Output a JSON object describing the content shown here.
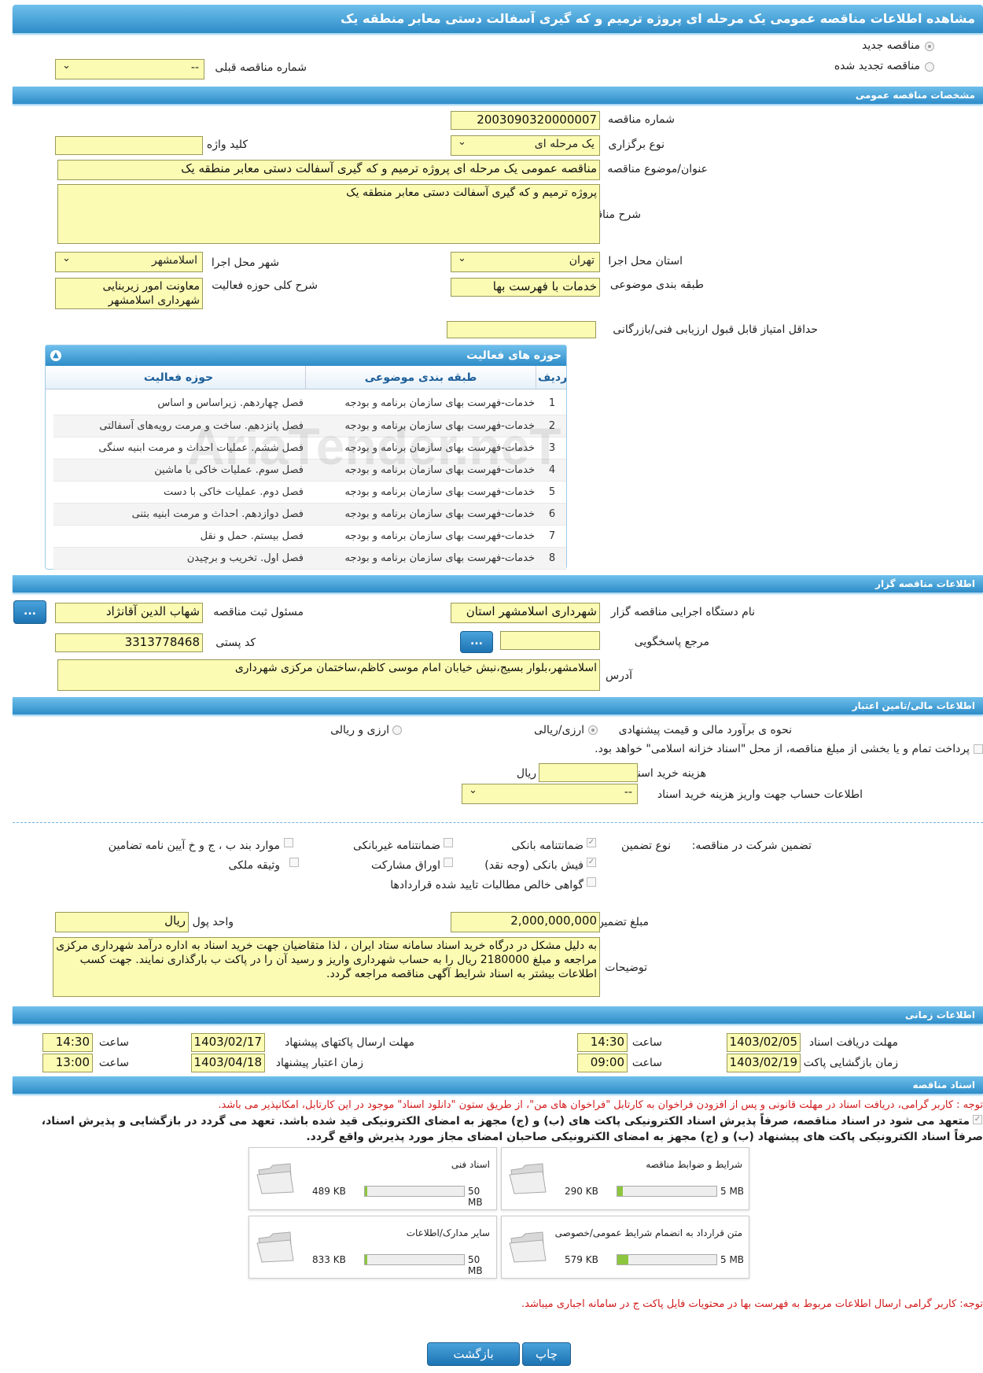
{
  "header": {
    "title": "مشاهده اطلاعات مناقصه عمومی یک مرحله ای پروژه ترمیم و که گیری آسفالت دستی معابر منطقه یک"
  },
  "top": {
    "new_tender": "مناقصه جدید",
    "renewed_tender": "مناقصه تجدید شده",
    "prev_tender_label": "شماره مناقصه قبلی",
    "prev_tender_value": "--"
  },
  "general": {
    "section": "مشخصات مناقصه عمومی",
    "number_label": "شماره مناقصه",
    "number": "2003090320000007",
    "type_label": "نوع برگزاری",
    "type": "یک مرحله ای",
    "keyword_label": "کلید واژه",
    "title_label": "عنوان/موضوع مناقصه",
    "title": "مناقصه عمومی یک مرحله ای پروژه ترمیم و که گیری آسفالت دستی معابر منطقه یک",
    "desc_label": "شرح مناقصه",
    "desc": "پروژه ترمیم و که گیری آسفالت دستی معابر منطقه یک",
    "province_label": "استان محل اجرا",
    "province": "تهران",
    "city_label": "شهر محل اجرا",
    "city": "اسلامشهر",
    "category_label": "طبقه بندی موضوعی",
    "category": "خدمات با فهرست بها",
    "activity_desc_label": "شرح کلی حوزه فعالیت",
    "activity_desc": "معاونت امور زیربنایی شهرداری اسلامشهر",
    "min_score_label": "حداقل امتیاز قابل قبول ارزیابی فنی/بازرگانی"
  },
  "activities": {
    "title": "حوزه های فعالیت",
    "headers": [
      "ردیف",
      "طبقه بندی موضوعی",
      "حوزه فعالیت"
    ],
    "rows": [
      [
        "1",
        "خدمات-فهرست بهای سازمان برنامه و بودجه",
        "فصل چهاردهم. زیراساس و اساس"
      ],
      [
        "2",
        "خدمات-فهرست بهای سازمان برنامه و بودجه",
        "فصل پانزدهم. ساخت و مرمت رویه‌های آسفالتی"
      ],
      [
        "3",
        "خدمات-فهرست بهای سازمان برنامه و بودجه",
        "فصل ششم.  عملیات احداث و مرمت ابنیه سنگی"
      ],
      [
        "4",
        "خدمات-فهرست بهای سازمان برنامه و بودجه",
        "فصل سوم. عملیات خاکی با ماشین"
      ],
      [
        "5",
        "خدمات-فهرست بهای سازمان برنامه و بودجه",
        "فصل دوم. عملیات خاکی با دست"
      ],
      [
        "6",
        "خدمات-فهرست بهای سازمان برنامه و بودجه",
        "فصل دوازدهم. احداث و مرمت ابنیه بتنی"
      ],
      [
        "7",
        "خدمات-فهرست بهای سازمان برنامه و بودجه",
        "فصل بیستم. حمل و نقل"
      ],
      [
        "8",
        "خدمات-فهرست بهای سازمان برنامه و بودجه",
        "فصل اول. تخریب و برچیدن"
      ]
    ]
  },
  "organizer": {
    "section": "اطلاعات مناقصه گزار",
    "org_label": "نام دستگاه اجرایی مناقصه گزار",
    "org": "شهرداری اسلامشهر استان",
    "resp_label": "مسئول ثبت مناقصه",
    "resp": "شهاب الدین آقانژاد",
    "ref_label": "مرجع پاسخگویی",
    "postal_label": "کد پستی",
    "postal": "3313778468",
    "addr_label": "آدرس",
    "addr": "اسلامشهر،بلوار بسیج،نبش خیابان امام موسی کاظم،ساختمان مرکزی شهرداری",
    "dots": "..."
  },
  "finance": {
    "section": "اطلاعات مالی/تامین اعتبار",
    "estimate_label": "نحوه ی برآورد مالی و قیمت پیشنهادی",
    "opt1": "ارزی/ریالی",
    "opt2": "ارزی و ریالی",
    "treasury": "پرداخت تمام و یا بخشی از مبلغ مناقصه، از محل \"اسناد خزانه اسلامی\" خواهد بود.",
    "doc_cost_label": "هزینه خرید اسناد",
    "doc_cost_unit": "ریال",
    "account_label": "اطلاعات حساب جهت واریز هزینه خرید اسناد",
    "account": "--"
  },
  "guarantee": {
    "label": "تضمین شرکت در مناقصه:",
    "type_label": "نوع تضمین",
    "opts": [
      "ضمانتنامه بانکی",
      "ضمانتنامه غیربانکی",
      "موارد بند ب ، ج و خ آیین نامه تضامین",
      "فیش بانکی (وجه نقد)",
      "اوراق مشارکت",
      "وثیقه ملکی",
      "گواهی خالص مطالبات تایید شده قراردادها"
    ],
    "amount_label": "مبلغ تضمین",
    "amount": "2,000,000,000",
    "unit_label": "واحد پول",
    "unit": "ریال",
    "notes_label": "توضیحات",
    "notes": "به دلیل مشکل در درگاه خرید اسناد سامانه ستاد ایران ، لذا متقاضیان جهت خرید اسناد به اداره درآمد شهرداری مرکزی مراجعه و مبلغ 2180000 ریال را به حساب شهرداری واریز و رسید آن را در پاکت ب بارگذاری نمایند. جهت کسب اطلاعات بیشتر به اسناد شرایط آگهی مناقصه مراجعه گردد."
  },
  "timing": {
    "section": "اطلاعات زمانی",
    "receive_label": "مهلت دریافت اسناد",
    "receive_date": "1403/02/05",
    "receive_time": "14:30",
    "send_label": "مهلت ارسال پاکتهای پیشنهاد",
    "send_date": "1403/02/17",
    "send_time": "14:30",
    "open_label": "زمان بازگشایی پاکت ها",
    "open_date": "1403/02/19",
    "open_time": "09:00",
    "valid_label": "زمان اعتبار پیشنهاد",
    "valid_date": "1403/04/18",
    "valid_time": "13:00",
    "time_label": "ساعت"
  },
  "docs": {
    "section": "اسناد مناقصه",
    "note1": "توجه : کاربر گرامی، دریافت اسناد در مهلت قانونی و پس از افزودن فراخوان به کارتابل \"فراخوان های من\"، از طریق ستون \"دانلود اسناد\" موجود در این کارتابل، امکانپذیر می باشد.",
    "commit1": "متعهد می شود در اسناد مناقصه، صرفاً پذیرش اسناد الکترونیکی پاکت های (ب) و (ج) مجهز به امضای الکترونیکی قید شده باشد. تعهد می گردد در بازگشایی و پذیرش اسناد،",
    "commit2": "صرفاً اسناد الکترونیکی پاکت های پیشنهاد (ب) و (ج) مجهز به امضای الکترونیکی صاحبان امضای مجاز مورد پذیرش واقع گردد.",
    "files": [
      {
        "name": "شرایط و ضوابط مناقصه",
        "size": "290 KB",
        "max": "5 MB",
        "ratio": 0.057
      },
      {
        "name": "اسناد فنی",
        "size": "489 KB",
        "max": "50 MB",
        "ratio": 0.02
      },
      {
        "name": "متن قرارداد به انضمام شرایط عمومی/خصوصی",
        "size": "579 KB",
        "max": "5 MB",
        "ratio": 0.115
      },
      {
        "name": "سایر مدارک/اطلاعات",
        "size": "833 KB",
        "max": "50 MB",
        "ratio": 0.02
      }
    ],
    "note2": "توجه: کاربر گرامی ارسال اطلاعات مربوط به فهرست بها در محتویات فایل پاکت ج در سامانه اجباری میباشد."
  },
  "actions": {
    "print": "چاپ",
    "back": "بازگشت"
  },
  "watermark": "AriaTender.neT"
}
